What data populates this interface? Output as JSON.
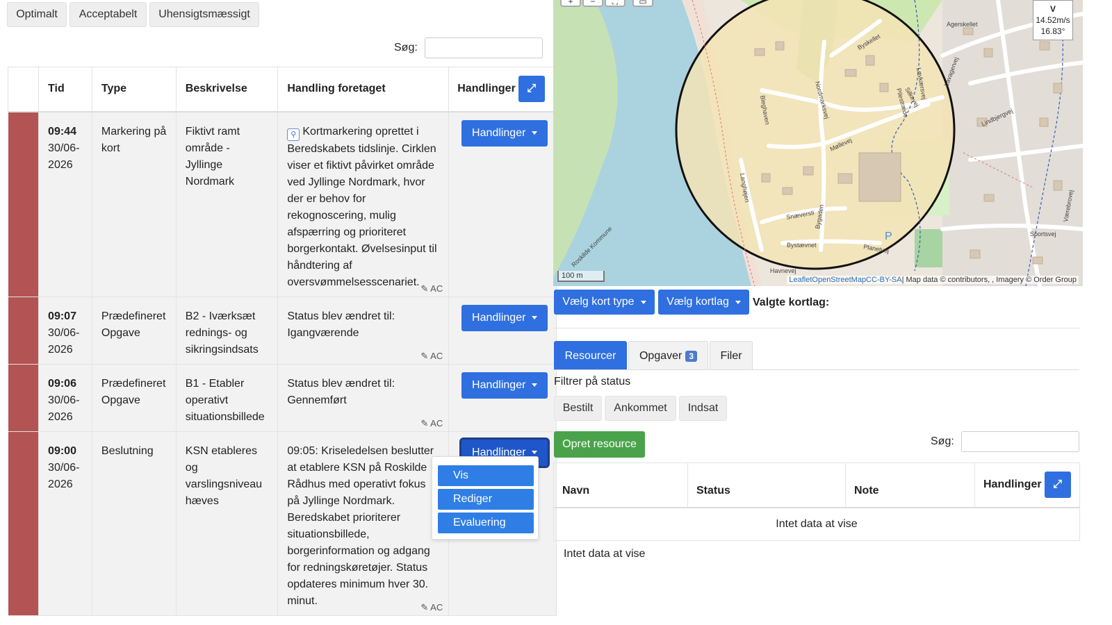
{
  "filters": [
    "Optimalt",
    "Acceptabelt",
    "Uhensigtsmæssigt"
  ],
  "log_search_label": "Søg:",
  "log_table": {
    "headers": [
      "Tid",
      "Type",
      "Beskrivelse",
      "Handling foretaget",
      "Handlinger"
    ],
    "rows": [
      {
        "time": "09:44",
        "date": "30/06-2026",
        "type": "Markering på kort",
        "desc": "Fiktivt ramt område - Jyllinge Nordmark",
        "action": "Kortmarkering oprettet i Beredskabets tidslinje. Cirklen viser et fiktivt påvirket område ved Jyllinge Nordmark, hvor der er behov for rekognoscering, mulig afspærring og prioriteret borgerkontakt. Øvelsesinput til håndtering af oversvømmelsesscenariet.",
        "author": "AC",
        "button": "Handlinger"
      },
      {
        "time": "09:07",
        "date": "30/06-2026",
        "type": "Prædefineret Opgave",
        "desc": "B2 - Iværksæt rednings- og sikringsindsats",
        "action": "Status blev ændret til: Igangværende",
        "author": "AC",
        "button": "Handlinger"
      },
      {
        "time": "09:06",
        "date": "30/06-2026",
        "type": "Prædefineret Opgave",
        "desc": "B1 - Etabler operativt situationsbillede",
        "action": "Status blev ændret til: Gennemført",
        "author": "AC",
        "button": "Handlinger"
      },
      {
        "time": "09:00",
        "date": "30/06-2026",
        "type": "Beslutning",
        "desc": "KSN etableres og varslingsniveau hæves",
        "action": "09:05: Kriseledelsen beslutter at etablere KSN på Roskilde Rådhus med operativt fokus på Jyllinge Nordmark. Beredskabet prioriterer situationsbillede, borgerinformation og adgang for redningskøretøjer. Status opdateres minimum hver 30. minut.",
        "author": "AC",
        "button": "Handlinger"
      }
    ]
  },
  "dropdown": [
    "Vis",
    "Rediger",
    "Evaluering"
  ],
  "map": {
    "attribution_links": "LeafletOpenStreetMapCC-BY-SA",
    "attribution_text": "| Map data © contributors, , Imagery © Order Group",
    "scale": "100 m",
    "weather_dir": "V",
    "weather_speed": "14.52m/s",
    "weather_temp": "16.83°",
    "streets": [
      "Agerskellet",
      "Byskellet",
      "Nordmarksvej",
      "Møllevej",
      "Løvkærsvej",
      "Pilestræde",
      "Silkevej",
      "Lindbjergvej",
      "Bleghaven",
      "Langhøjen",
      "Snæversti",
      "Bystævnet",
      "Bygaden",
      "Planetvej",
      "Havnevej",
      "Sportsvej",
      "Roskilde Kommune",
      "Værebrovej",
      "Lavagervej"
    ]
  },
  "map_buttons": {
    "layer_type": "Vælg kort type",
    "layer": "Vælg kortlag",
    "selected_label": "Valgte kortlag:"
  },
  "tabs": [
    {
      "label": "Resourcer"
    },
    {
      "label": "Opgaver",
      "badge": "3"
    },
    {
      "label": "Filer"
    }
  ],
  "status_filter_label": "Filtrer på status",
  "status_filters": [
    "Bestilt",
    "Ankommet",
    "Indsat"
  ],
  "create_resource": "Opret resource",
  "res_search_label": "Søg:",
  "res_table": {
    "headers": [
      "Navn",
      "Status",
      "Note",
      "Handlinger"
    ],
    "empty": "Intet data at vise"
  },
  "empty_below": "Intet data at vise",
  "colors": {
    "primary": "#2f6fe0",
    "stripe": "#b35353",
    "success": "#4caf50"
  }
}
